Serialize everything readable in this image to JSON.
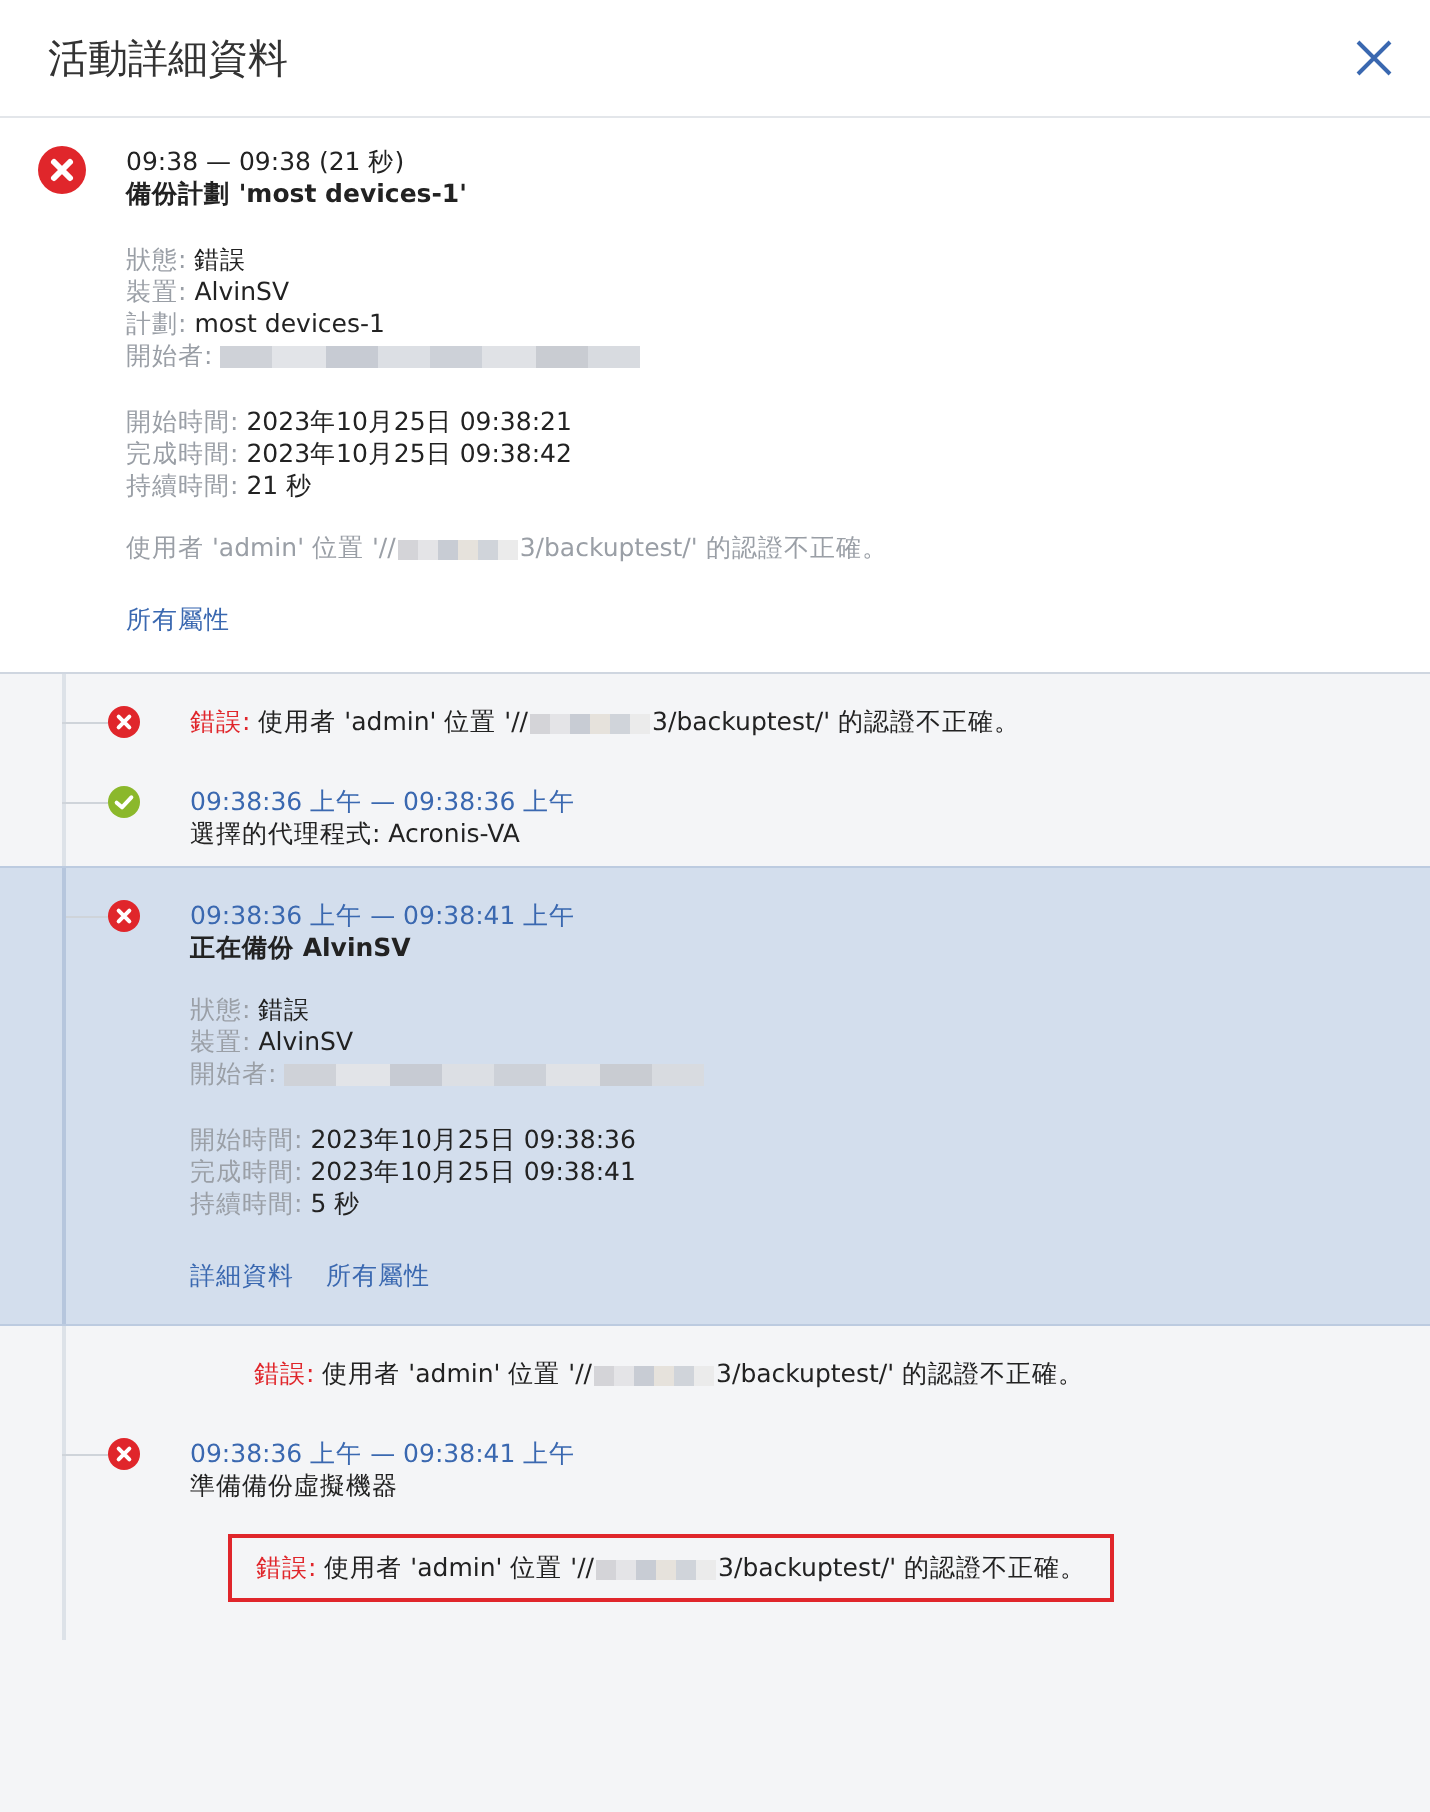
{
  "dialog": {
    "title": "活動詳細資料"
  },
  "summary": {
    "failed": true,
    "time": "09:38 — 09:38 (21 秒)",
    "title": "備份計劃 'most devices-1'",
    "fields": [
      {
        "label": "狀態:",
        "value": "錯誤"
      },
      {
        "label": "裝置:",
        "value": "AlvinSV"
      },
      {
        "label": "計劃:",
        "value": "most devices-1"
      },
      {
        "label": "開始者:",
        "kind": "redacted"
      }
    ],
    "times": [
      {
        "label": "開始時間:",
        "value": "2023年10月25日 09:38:21"
      },
      {
        "label": "完成時間:",
        "value": "2023年10月25日 09:38:42"
      },
      {
        "label": "持續時間:",
        "value": "21 秒"
      }
    ],
    "message": {
      "before": "使用者 'admin' 位置 '//",
      "after": "3/backuptest/' 的認證不正確。"
    },
    "links": [
      "所有屬性"
    ]
  },
  "entries": [
    {
      "kind": "error",
      "label": "錯誤:",
      "message": {
        "before": "使用者 'admin' 位置 '//",
        "after": "3/backuptest/' 的認證不正確。"
      }
    },
    {
      "kind": "step",
      "failed": false,
      "selected": false,
      "time": "09:38:36 上午 — 09:38:36 上午",
      "title": "選擇的代理程式: Acronis-VA"
    },
    {
      "kind": "step",
      "failed": true,
      "selected": true,
      "time": "09:38:36 上午 — 09:38:41 上午",
      "title": "正在備份 AlvinSV",
      "fields": [
        {
          "label": "狀態:",
          "value": "錯誤"
        },
        {
          "label": "裝置:",
          "value": "AlvinSV"
        },
        {
          "label": "開始者:",
          "kind": "redacted"
        }
      ],
      "times": [
        {
          "label": "開始時間:",
          "value": "2023年10月25日 09:38:36"
        },
        {
          "label": "完成時間:",
          "value": "2023年10月25日 09:38:41"
        },
        {
          "label": "持續時間:",
          "value": "5 秒"
        }
      ],
      "links": [
        "詳細資料",
        "所有屬性"
      ]
    },
    {
      "kind": "sub_error",
      "outlined": false,
      "label": "錯誤:",
      "message": {
        "before": "使用者 'admin' 位置 '//",
        "after": "3/backuptest/' 的認證不正確。"
      }
    },
    {
      "kind": "step",
      "failed": true,
      "selected": false,
      "time": "09:38:36 上午 — 09:38:41 上午",
      "title": "準備備份虛擬機器"
    },
    {
      "kind": "sub_error",
      "outlined": true,
      "label": "錯誤:",
      "message": {
        "before": "使用者 'admin' 位置 '//",
        "after": "3/backuptest/' 的認證不正確。"
      }
    }
  ]
}
